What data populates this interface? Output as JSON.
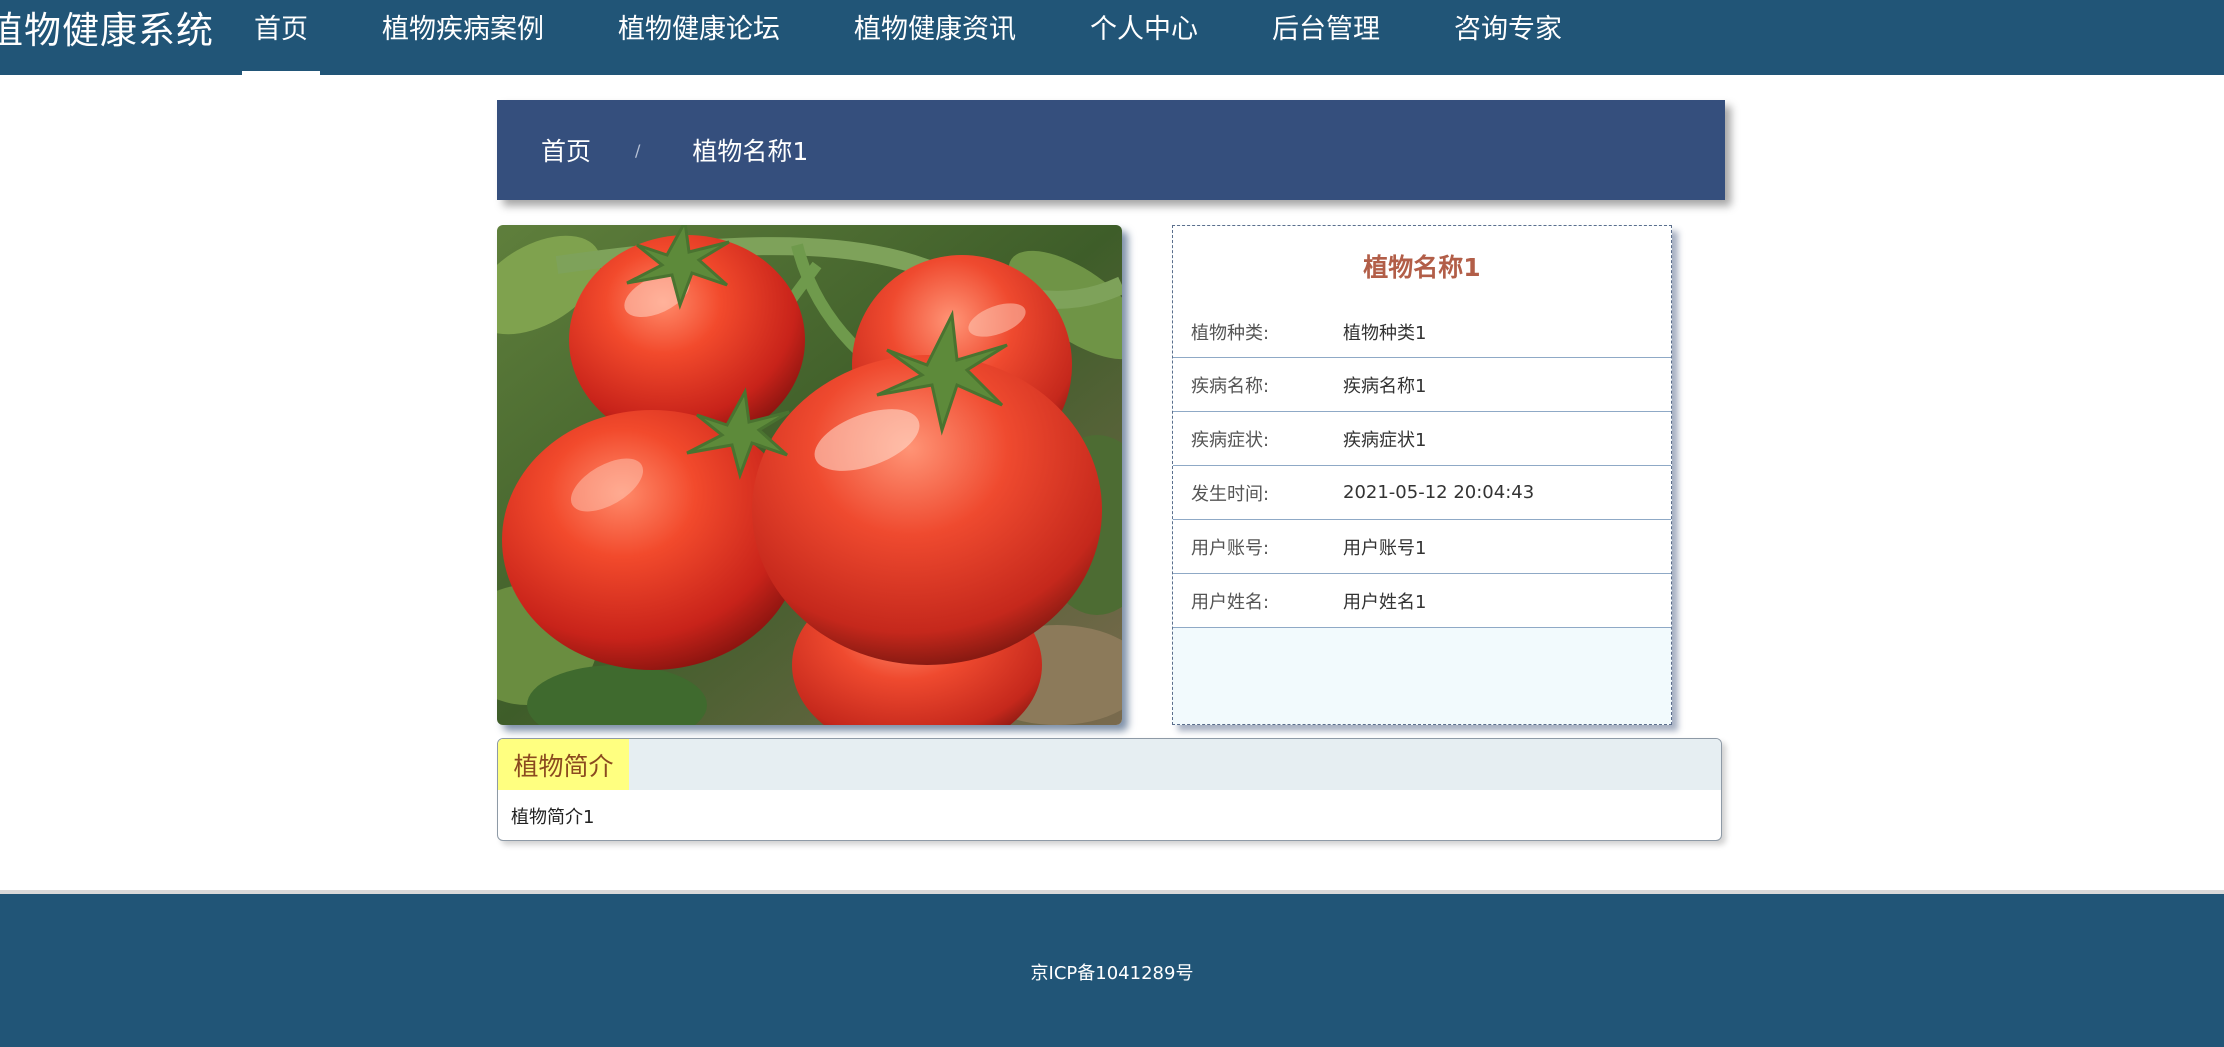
{
  "header": {
    "brand": "植物健康系统",
    "nav": [
      {
        "label": "首页",
        "active": true
      },
      {
        "label": "植物疾病案例",
        "active": false
      },
      {
        "label": "植物健康论坛",
        "active": false
      },
      {
        "label": "植物健康资讯",
        "active": false
      },
      {
        "label": "个人中心",
        "active": false
      },
      {
        "label": "后台管理",
        "active": false
      },
      {
        "label": "咨询专家",
        "active": false
      }
    ]
  },
  "breadcrumb": {
    "home": "首页",
    "separator": "/",
    "current": "植物名称1"
  },
  "photo": {
    "icon": "tomato-photo"
  },
  "details": {
    "title": "植物名称1",
    "rows": [
      {
        "label": "植物种类:",
        "value": "植物种类1"
      },
      {
        "label": "疾病名称:",
        "value": "疾病名称1"
      },
      {
        "label": "疾病症状:",
        "value": "疾病症状1"
      },
      {
        "label": "发生时间:",
        "value": "2021-05-12 20:04:43"
      },
      {
        "label": "用户账号:",
        "value": "用户账号1"
      },
      {
        "label": "用户姓名:",
        "value": "用户姓名1"
      }
    ]
  },
  "intro": {
    "tab_label": "植物简介",
    "content": "植物简介1"
  },
  "footer": {
    "icp": "京ICP备1041289号"
  },
  "colors": {
    "nav_bg": "#215577",
    "banner_bg": "#354f7d",
    "title_accent": "#b25e48",
    "tab_bg": "#ffff80"
  }
}
